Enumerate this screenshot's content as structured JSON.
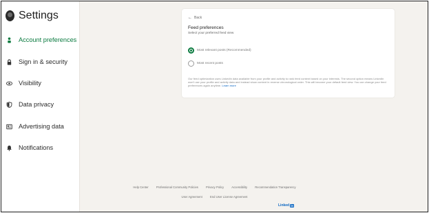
{
  "sidebar": {
    "title": "Settings",
    "items": [
      {
        "label": "Account preferences",
        "icon": "person-icon"
      },
      {
        "label": "Sign in & security",
        "icon": "lock-icon"
      },
      {
        "label": "Visibility",
        "icon": "eye-icon"
      },
      {
        "label": "Data privacy",
        "icon": "shield-icon"
      },
      {
        "label": "Advertising data",
        "icon": "newspaper-icon"
      },
      {
        "label": "Notifications",
        "icon": "bell-icon"
      }
    ]
  },
  "card": {
    "back_label": "Back",
    "title": "Feed preferences",
    "subtitle": "Select your preferred feed view",
    "options": [
      {
        "label": "Most relevant posts (Recommended)",
        "selected": true
      },
      {
        "label": "Most recent posts",
        "selected": false
      }
    ],
    "description": "Our feed optimization uses LinkedIn data available from your profile and activity to rank feed content based on your interests. The second option means LinkedIn won't use your profile and activity data and instead show content in reverse chronological order. This will become your default feed view. You can change your feed preferences again anytime.",
    "learn_more": "Learn more"
  },
  "footer": {
    "row1": [
      "Help Center",
      "Professional Community Policies",
      "Privacy Policy",
      "Accessibility",
      "Recommendation Transparency"
    ],
    "row2": [
      "User Agreement",
      "End User License Agreement"
    ],
    "brand": "Linked",
    "brand_in": "in"
  },
  "colors": {
    "accent": "#0a7a3f",
    "link": "#0a66c2",
    "background": "#f4f2ee"
  }
}
